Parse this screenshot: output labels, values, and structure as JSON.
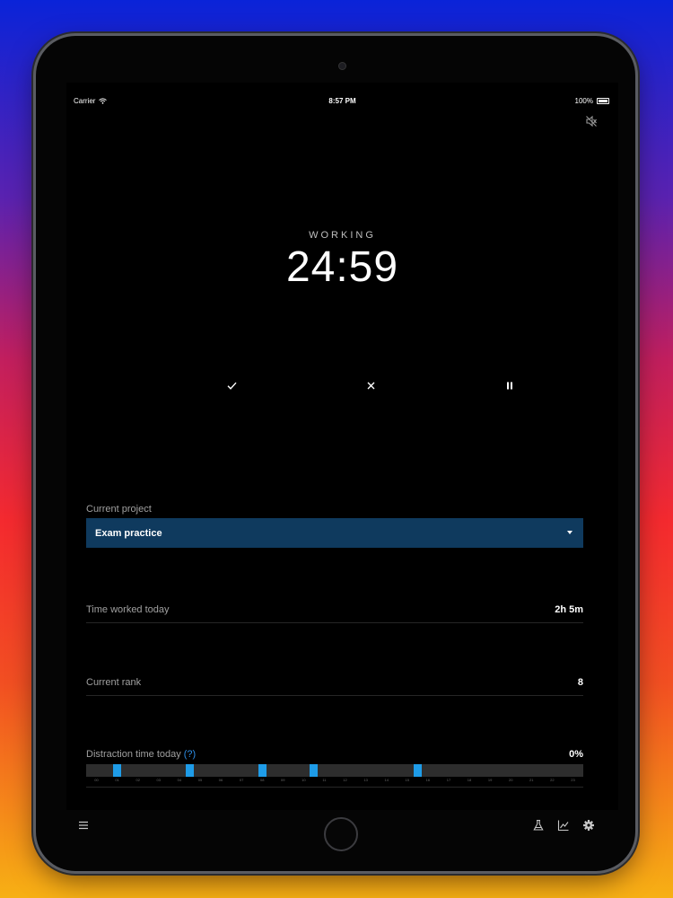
{
  "status_bar": {
    "carrier": "Carrier",
    "time": "8:57 PM",
    "battery": "100%"
  },
  "timer": {
    "mode": "WORKING",
    "remaining": "24:59"
  },
  "controls": {
    "complete_icon": "check-icon",
    "cancel_icon": "close-icon",
    "pause_icon": "pause-icon"
  },
  "project": {
    "label": "Current project",
    "selected": "Exam practice"
  },
  "stats": {
    "time_worked_label": "Time worked today",
    "time_worked_value": "2h 5m",
    "rank_label": "Current rank",
    "rank_value": "8",
    "distraction_label": "Distraction time today",
    "distraction_help": "(?)",
    "distraction_value": "0%"
  },
  "timeline": {
    "hour_labels": [
      "00",
      "01",
      "02",
      "03",
      "04",
      "05",
      "06",
      "07",
      "08",
      "09",
      "10",
      "11",
      "12",
      "13",
      "14",
      "15",
      "16",
      "17",
      "18",
      "19",
      "20",
      "21",
      "22",
      "23"
    ],
    "session_hours": [
      1.5,
      5.0,
      8.5,
      11.0,
      16.0
    ],
    "bar_color": "#1e9ce8"
  },
  "toolbar": {
    "menu_icon": "menu-icon",
    "lab_icon": "flask-icon",
    "stats_icon": "chart-icon",
    "settings_icon": "gear-icon"
  },
  "colors": {
    "accent": "#0f3a5e",
    "link": "#2e8ee6"
  }
}
